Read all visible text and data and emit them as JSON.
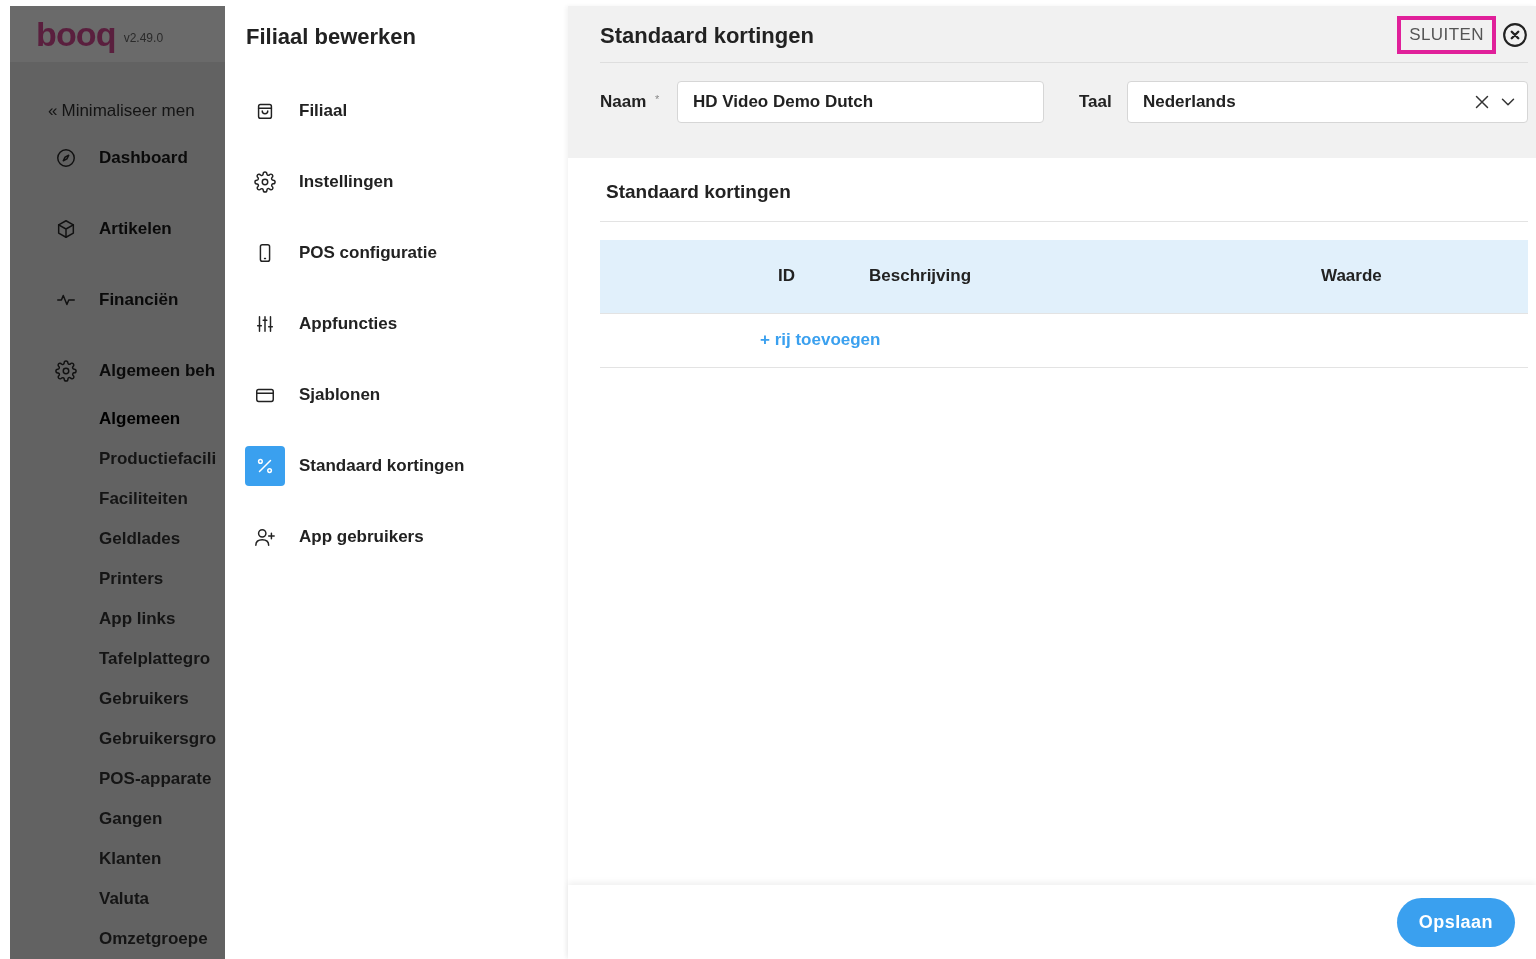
{
  "app_sidebar": {
    "logo": "booq",
    "version": "v2.49.0",
    "collapse": {
      "icon": "«",
      "label": "Minimaliseer men"
    },
    "items": [
      {
        "label": "Dashboard"
      },
      {
        "label": "Artikelen"
      },
      {
        "label": "Financiën"
      },
      {
        "label": "Algemeen beh"
      }
    ],
    "subitems": [
      {
        "label": "Algemeen",
        "selected": true
      },
      {
        "label": "Productiefacili",
        "selected": false
      },
      {
        "label": "Faciliteiten",
        "selected": false
      },
      {
        "label": "Geldlades",
        "selected": false
      },
      {
        "label": "Printers",
        "selected": false
      },
      {
        "label": "App links",
        "selected": false
      },
      {
        "label": "Tafelplattegro",
        "selected": false
      },
      {
        "label": "Gebruikers",
        "selected": false
      },
      {
        "label": "Gebruikersgro",
        "selected": false
      },
      {
        "label": "POS-apparate",
        "selected": false
      },
      {
        "label": "Gangen",
        "selected": false
      },
      {
        "label": "Klanten",
        "selected": false
      },
      {
        "label": "Valuta",
        "selected": false
      },
      {
        "label": "Omzetgroepe",
        "selected": false
      }
    ]
  },
  "edit_menu": {
    "title": "Filiaal bewerken",
    "items": [
      {
        "label": "Filiaal",
        "selected": false
      },
      {
        "label": "Instellingen",
        "selected": false
      },
      {
        "label": "POS configuratie",
        "selected": false
      },
      {
        "label": "Appfuncties",
        "selected": false
      },
      {
        "label": "Sjablonen",
        "selected": false
      },
      {
        "label": "Standaard kortingen",
        "selected": true
      },
      {
        "label": "App gebruikers",
        "selected": false
      }
    ]
  },
  "panel": {
    "title": "Standaard kortingen",
    "close": {
      "label": "SLUITEN",
      "highlighted": true
    },
    "name_field": {
      "label": "Naam",
      "required": true,
      "required_mark": "*",
      "value": "HD Video Demo Dutch"
    },
    "language_field": {
      "label": "Taal",
      "value": "Nederlands"
    },
    "section_title": "Standaard kortingen",
    "table": {
      "columns": [
        "ID",
        "Beschrijving",
        "Waarde"
      ]
    },
    "add_row": "+ rij toevoegen",
    "save_button": "Opslaan"
  }
}
